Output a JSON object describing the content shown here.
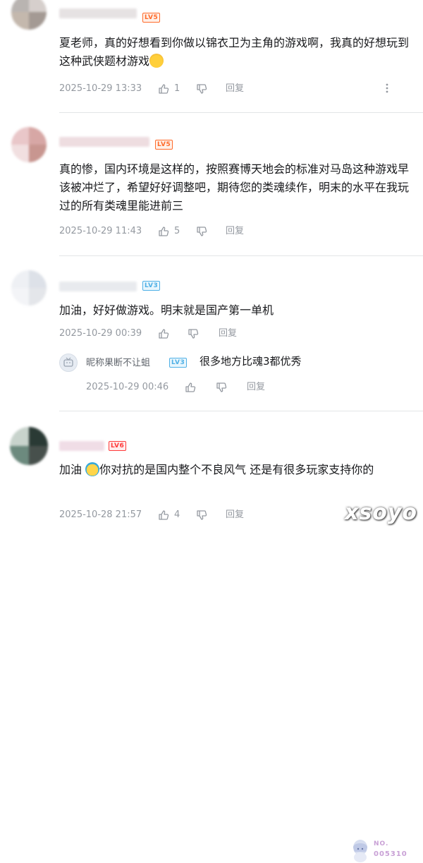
{
  "comments": [
    {
      "level": "LV5",
      "content": "夏老师，真的好想看到你做以锦衣卫为主角的游戏啊，我真的好想玩到这种武侠题材游戏",
      "date": "2025-10-29 13:33",
      "likes": "1",
      "reply_label": "回复"
    },
    {
      "level": "LV5",
      "content": "真的惨，国内环境是这样的，按照赛博天地会的标准对马岛这种游戏早该被冲烂了，希望好好调整吧，期待您的类魂续作，明末的水平在我玩过的所有类魂里能进前三",
      "date": "2025-10-29 11:43",
      "likes": "5",
      "reply_label": "回复"
    },
    {
      "level": "LV3",
      "content": "加油，好好做游戏。明末就是国产第一单机",
      "date": "2025-10-29 00:39",
      "reply_label": "回复",
      "reply": {
        "name": "昵称果断不让蛆",
        "level": "LV3",
        "text": "很多地方比魂3都优秀",
        "date": "2025-10-29 00:46",
        "reply_label": "回复"
      }
    },
    {
      "level": "LV6",
      "content_a": "加油",
      "content_b": "你对抗的是国内整个不良风气 还是有很多玩家支持你的",
      "date": "2025-10-28 21:57",
      "likes": "4",
      "reply_label": "回复",
      "badge_no": "NO.",
      "badge_num": "005310"
    }
  ],
  "watermark": "xsoyo",
  "icons": [
    "thumb-up-icon",
    "thumb-down-icon",
    "more-icon",
    "emoji-icon"
  ]
}
